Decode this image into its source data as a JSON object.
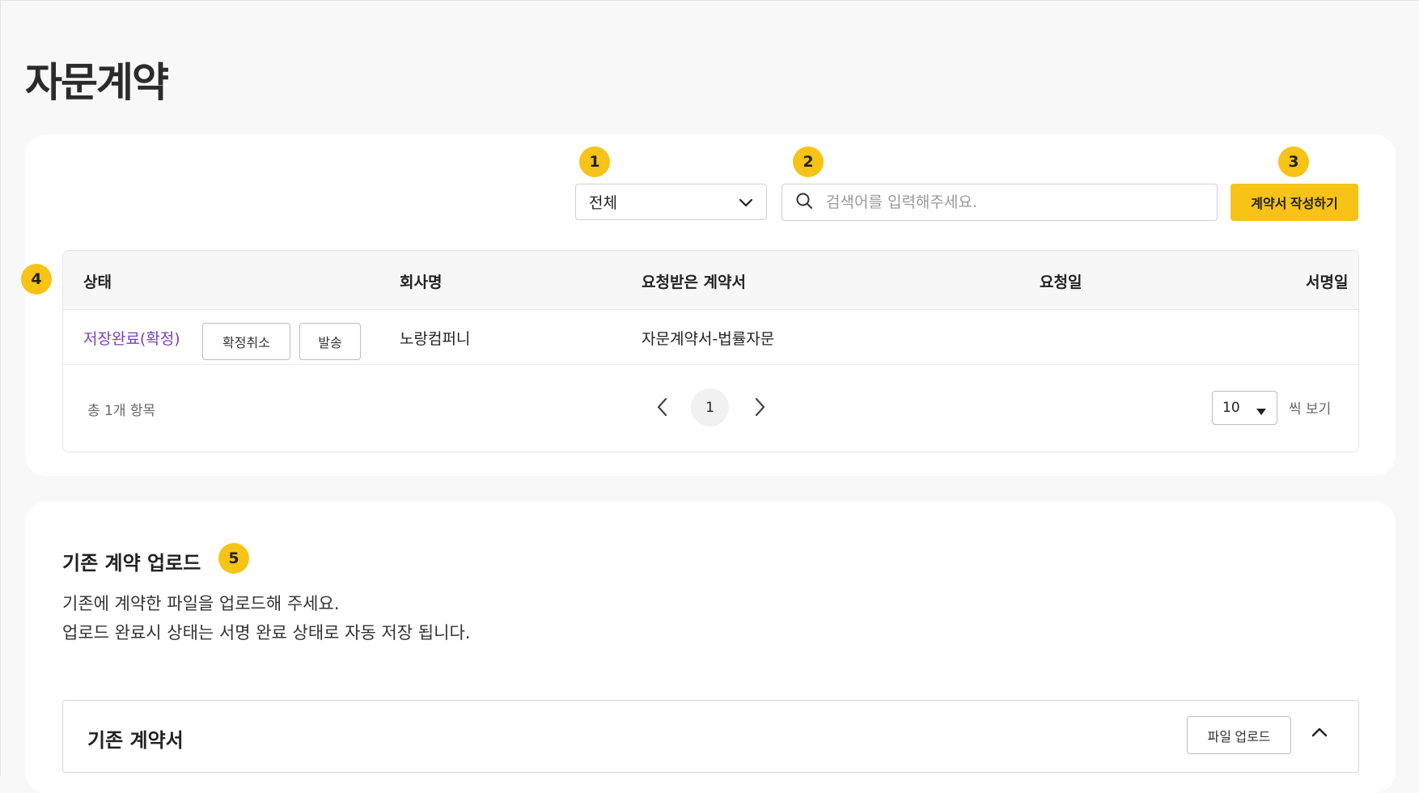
{
  "page": {
    "title": "자문계약"
  },
  "badges": {
    "b1": "1",
    "b2": "2",
    "b3": "3",
    "b4": "4",
    "b5": "5"
  },
  "toolbar": {
    "filter_value": "전체",
    "search_placeholder": "검색어를 입력해주세요.",
    "create_button": "계약서 작성하기"
  },
  "table": {
    "headers": [
      "상태",
      "회사명",
      "요청받은 계약서",
      "요청일",
      "서명일"
    ],
    "rows": [
      {
        "status": "저장완료(확정)",
        "cancel_button": "확정취소",
        "send_button": "발송",
        "company": "노랑컴퍼니",
        "contract": "자문계약서-법률자문",
        "requested": "",
        "signed": ""
      }
    ],
    "total": "총 1개 항목",
    "current_page": "1",
    "page_size": "10",
    "page_size_suffix": "씩 보기"
  },
  "upload": {
    "title": "기존 계약 업로드",
    "desc_line1": "기존에 계약한 파일을 업로드해 주세요.",
    "desc_line2": "업로드 완료시 상태는 서명 완료 상태로 자동 저장 됩니다.",
    "section_title": "기존 계약서",
    "upload_button": "파일 업로드"
  },
  "colors": {
    "accent": "#f7c316",
    "status_purple": "#7b3fc4",
    "background": "#f8f8f9"
  },
  "icons": {
    "select": "chevron-down-icon",
    "search": "search-icon",
    "prev": "chevron-left-icon",
    "next": "chevron-right-icon",
    "pagesize": "caret-down-icon",
    "accordion": "chevron-up-icon"
  }
}
